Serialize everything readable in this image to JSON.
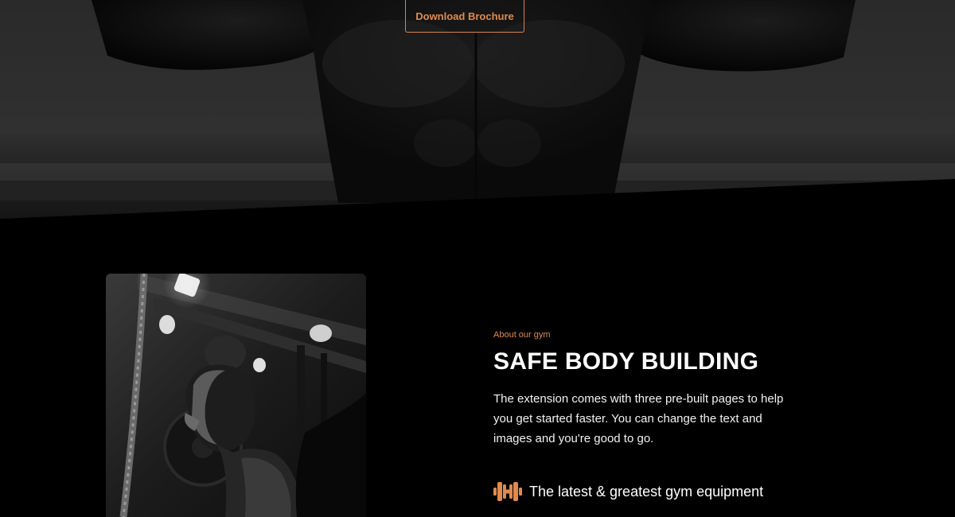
{
  "hero": {
    "button_label": "Download Brochure"
  },
  "about": {
    "kicker": "About our gym",
    "title": "SAFE BODY BUILDING",
    "body": "The extension comes with three pre-built pages to help you get started faster. You can change the text and images and you're good to go.",
    "features": [
      {
        "icon": "dumbbell-icon",
        "label": "The latest & greatest gym equipment"
      }
    ]
  },
  "colors": {
    "accent": "#e08a4d",
    "background": "#000000",
    "text": "#ffffff"
  }
}
